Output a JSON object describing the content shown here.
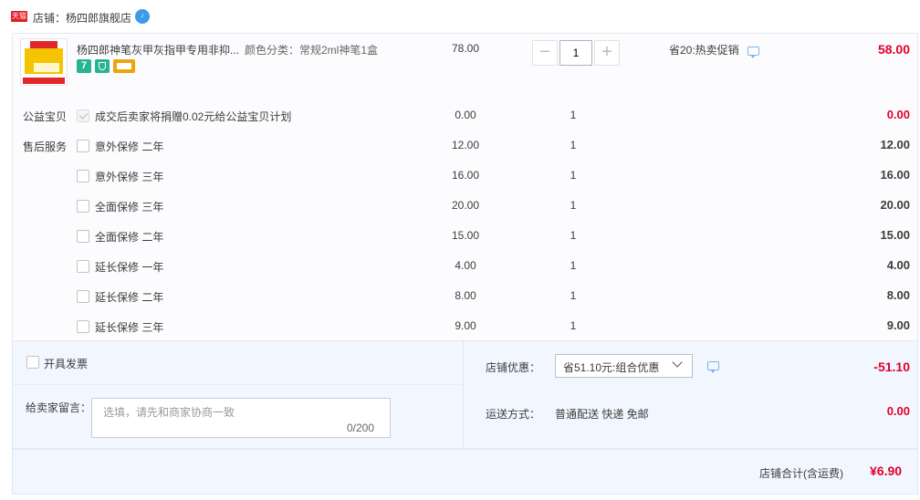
{
  "shop": {
    "badge": "天猫",
    "name_label": "店铺：杨四郎旗舰店",
    "ww_icon": "wangwang-chat-icon"
  },
  "product": {
    "title": "杨四郎神笔灰甲灰指甲专用非抑...",
    "sku": "颜色分类：常规2ml神笔1盒",
    "price": "78.00",
    "quantity": "1",
    "qty_minus": "−",
    "qty_plus": "+",
    "badge_seven": "7",
    "promo": "省20:热卖促销",
    "subtotal": "58.00"
  },
  "services": {
    "charity_label": "公益宝贝",
    "aftersale_label": "售后服务",
    "rows": [
      {
        "name": "成交后卖家将捐赠0.02元给公益宝贝计划",
        "price": "0.00",
        "qty": "1",
        "subtotal": "0.00"
      },
      {
        "name": "意外保修 二年",
        "price": "12.00",
        "qty": "1",
        "subtotal": "12.00"
      },
      {
        "name": "意外保修 三年",
        "price": "16.00",
        "qty": "1",
        "subtotal": "16.00"
      },
      {
        "name": "全面保修 三年",
        "price": "20.00",
        "qty": "1",
        "subtotal": "20.00"
      },
      {
        "name": "全面保修 二年",
        "price": "15.00",
        "qty": "1",
        "subtotal": "15.00"
      },
      {
        "name": "延长保修 一年",
        "price": "4.00",
        "qty": "1",
        "subtotal": "4.00"
      },
      {
        "name": "延长保修 二年",
        "price": "8.00",
        "qty": "1",
        "subtotal": "8.00"
      },
      {
        "name": "延长保修 三年",
        "price": "9.00",
        "qty": "1",
        "subtotal": "9.00"
      }
    ]
  },
  "order": {
    "invoice_label": "开具发票",
    "message_label": "给卖家留言：",
    "message_placeholder": "选填，请先和商家协商一致",
    "message_counter": "0/200",
    "shop_discount_label": "店铺优惠：",
    "shop_discount_selected": "省51.10元:组合优惠",
    "shop_discount_amount": "-51.10",
    "shipping_label": "运送方式：",
    "shipping_value": "普通配送 快递 免邮",
    "shipping_amount": "0.00",
    "total_label": "店铺合计(含运费)",
    "total_value": "¥6.90"
  },
  "colors": {
    "price_red": "#e1002b",
    "panel_blue": "#f2f7ff",
    "tmall_red": "#e21e27"
  }
}
